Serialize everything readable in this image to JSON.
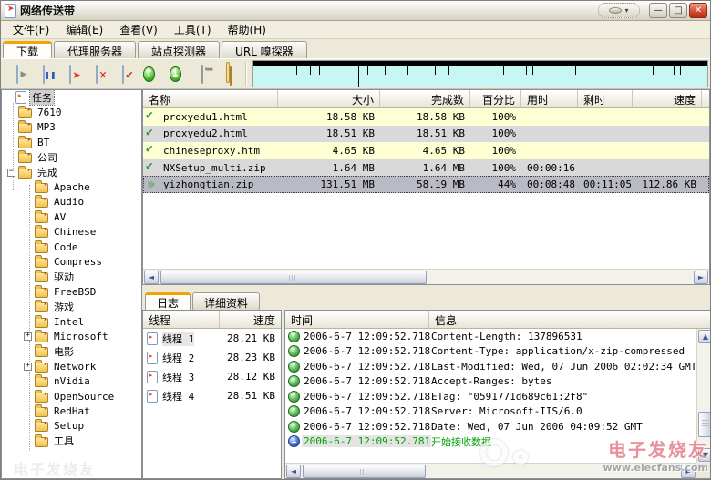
{
  "window": {
    "title": "网络传送带",
    "controls": {
      "minimize": "—",
      "maximize": "□",
      "close": "✕"
    }
  },
  "menu_bar": {
    "items": [
      {
        "label": "文件(F)"
      },
      {
        "label": "编辑(E)"
      },
      {
        "label": "查看(V)"
      },
      {
        "label": "工具(T)"
      },
      {
        "label": "帮助(H)"
      }
    ]
  },
  "main_tabs": {
    "items": [
      {
        "label": "下载",
        "active": true
      },
      {
        "label": "代理服务器"
      },
      {
        "label": "站点探测器"
      },
      {
        "label": "URL 嗅探器"
      }
    ]
  },
  "toolbar": {
    "buttons": [
      {
        "icon": "new-task-icon",
        "shape": "doc"
      },
      {
        "icon": "pause-icon",
        "shape": "doc"
      },
      {
        "icon": "start-icon",
        "shape": "doc"
      },
      {
        "icon": "delete-icon",
        "shape": "doc"
      },
      {
        "icon": "finish-icon",
        "shape": "doc"
      },
      {
        "icon": "move-up-icon",
        "shape": "circle",
        "glyph": "↑"
      },
      {
        "icon": "move-down-icon",
        "shape": "circle",
        "glyph": "↓"
      },
      {
        "icon": "open-folder-icon",
        "shape": "gray-folder"
      },
      {
        "icon": "category-folders-icon",
        "shape": "yellow-folders"
      }
    ],
    "speed_graph": {
      "bg_color": "#c6f7f5",
      "bar_color": "#000000",
      "ticks": [
        {
          "x": 9.5
        },
        {
          "x": 12.5
        },
        {
          "x": 14.5
        },
        {
          "x": 23,
          "tall": true
        },
        {
          "x": 25
        },
        {
          "x": 29
        },
        {
          "x": 34
        },
        {
          "x": 40
        },
        {
          "x": 43
        },
        {
          "x": 55
        },
        {
          "x": 60
        },
        {
          "x": 61.5
        },
        {
          "x": 70
        },
        {
          "x": 70.8
        },
        {
          "x": 88
        },
        {
          "x": 92.5
        },
        {
          "x": 94
        }
      ]
    }
  },
  "tree": {
    "items": [
      {
        "label": "任务",
        "level": 0,
        "icon": "doc-arrow-icon",
        "selected": true
      },
      {
        "label": "7610",
        "level": 1,
        "icon": "folder-icon"
      },
      {
        "label": "MP3",
        "level": 1,
        "icon": "folder-icon"
      },
      {
        "label": "BT",
        "level": 1,
        "icon": "folder-icon"
      },
      {
        "label": "公司",
        "level": 1,
        "icon": "folder-icon"
      },
      {
        "label": "完成",
        "level": 1,
        "icon": "folder-icon",
        "expander": "minus"
      },
      {
        "label": "Apache",
        "level": 2,
        "icon": "folder-icon"
      },
      {
        "label": "Audio",
        "level": 2,
        "icon": "folder-icon"
      },
      {
        "label": "AV",
        "level": 2,
        "icon": "folder-icon"
      },
      {
        "label": "Chinese",
        "level": 2,
        "icon": "folder-icon"
      },
      {
        "label": "Code",
        "level": 2,
        "icon": "folder-icon"
      },
      {
        "label": "Compress",
        "level": 2,
        "icon": "folder-icon"
      },
      {
        "label": "驱动",
        "level": 2,
        "icon": "folder-icon"
      },
      {
        "label": "FreeBSD",
        "level": 2,
        "icon": "folder-icon"
      },
      {
        "label": "游戏",
        "level": 2,
        "icon": "folder-icon"
      },
      {
        "label": "Intel",
        "level": 2,
        "icon": "folder-icon"
      },
      {
        "label": "Microsoft",
        "level": 2,
        "icon": "folder-icon",
        "expander": "plus"
      },
      {
        "label": "电影",
        "level": 2,
        "icon": "folder-icon"
      },
      {
        "label": "Network",
        "level": 2,
        "icon": "folder-icon",
        "expander": "plus"
      },
      {
        "label": "nVidia",
        "level": 2,
        "icon": "folder-icon"
      },
      {
        "label": "OpenSource",
        "level": 2,
        "icon": "folder-icon"
      },
      {
        "label": "RedHat",
        "level": 2,
        "icon": "folder-icon"
      },
      {
        "label": "Setup",
        "level": 2,
        "icon": "folder-icon"
      },
      {
        "label": "工具",
        "level": 2,
        "icon": "folder-icon"
      }
    ]
  },
  "task_list": {
    "columns": [
      {
        "label": "名称"
      },
      {
        "label": "大小"
      },
      {
        "label": "完成数"
      },
      {
        "label": "百分比"
      },
      {
        "label": "用时"
      },
      {
        "label": "剩时"
      },
      {
        "label": "速度"
      }
    ],
    "rows": [
      {
        "icon": "check-icon",
        "name": "proxyedu1.html",
        "size": "18.58 KB",
        "done": "18.58 KB",
        "percent": "100%",
        "elapsed": "",
        "left": "",
        "speed": ""
      },
      {
        "icon": "check-icon",
        "name": "proxyedu2.html",
        "size": "18.51 KB",
        "done": "18.51 KB",
        "percent": "100%",
        "elapsed": "",
        "left": "",
        "speed": ""
      },
      {
        "icon": "check-icon",
        "name": "chineseproxy.htm",
        "size": "4.65 KB",
        "done": "4.65 KB",
        "percent": "100%",
        "elapsed": "",
        "left": "",
        "speed": ""
      },
      {
        "icon": "check-icon",
        "name": "NXSetup_multi.zip",
        "size": "1.64 MB",
        "done": "1.64 MB",
        "percent": "100%",
        "elapsed": "00:00:16",
        "left": "",
        "speed": ""
      },
      {
        "icon": "download-arrow-icon",
        "name": "yizhongtian.zip",
        "size": "131.51 MB",
        "done": "58.19 MB",
        "percent": "44%",
        "elapsed": "00:08:48",
        "left": "00:11:05",
        "speed": "112.86 KB",
        "selected": true
      }
    ]
  },
  "bottom_panel": {
    "tabs": [
      {
        "label": "日志",
        "active": true
      },
      {
        "label": "详细资料"
      }
    ],
    "threads": {
      "columns": [
        {
          "label": "线程"
        },
        {
          "label": "速度"
        }
      ],
      "rows": [
        {
          "icon": "doc-arrow-icon",
          "name": "线程 1",
          "speed": "28.21 KB",
          "selected": true
        },
        {
          "icon": "doc-arrow-icon",
          "name": "线程 2",
          "speed": "28.23 KB"
        },
        {
          "icon": "doc-arrow-icon",
          "name": "线程 3",
          "speed": "28.12 KB"
        },
        {
          "icon": "doc-arrow-icon",
          "name": "线程 4",
          "speed": "28.51 KB"
        }
      ]
    },
    "log": {
      "columns": [
        {
          "label": "时间"
        },
        {
          "label": "信息"
        }
      ],
      "rows": [
        {
          "icon": "green-down-icon",
          "time": "2006-6-7 12:09:52.718",
          "info": "Content-Length: 137896531"
        },
        {
          "icon": "green-down-icon",
          "time": "2006-6-7 12:09:52.718",
          "info": "Content-Type: application/x-zip-compressed"
        },
        {
          "icon": "green-down-icon",
          "time": "2006-6-7 12:09:52.718",
          "info": "Last-Modified: Wed, 07 Jun 2006 02:02:34 GMT"
        },
        {
          "icon": "green-down-icon",
          "time": "2006-6-7 12:09:52.718",
          "info": "Accept-Ranges: bytes"
        },
        {
          "icon": "green-down-icon",
          "time": "2006-6-7 12:09:52.718",
          "info": "ETag: \"0591771d689c61:2f8\""
        },
        {
          "icon": "green-down-icon",
          "time": "2006-6-7 12:09:52.718",
          "info": "Server: Microsoft-IIS/6.0"
        },
        {
          "icon": "green-down-icon",
          "time": "2006-6-7 12:09:52.718",
          "info": "Date: Wed, 07 Jun 2006 04:09:52 GMT"
        },
        {
          "icon": "info-icon",
          "time": "2006-6-7 12:09:52.781",
          "info": "开始接收数据",
          "highlight": true
        }
      ]
    }
  },
  "colors": {
    "row_yellow": "#ffffd4",
    "row_gray": "#d9d9d9",
    "row_selected": "#b9bac4",
    "tab_accent": "#f0a500",
    "graph_bg": "#c6f7f5",
    "log_success_green": "#00a000",
    "close_red": "#d6492f"
  },
  "watermark": {
    "brand": "电子发烧友",
    "url": "www.elecfans.com"
  }
}
